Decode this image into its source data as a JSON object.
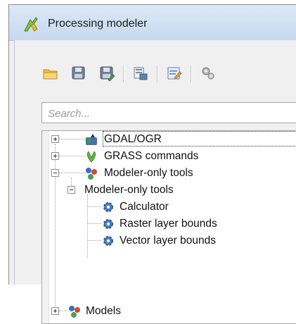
{
  "window": {
    "title": "Processing modeler"
  },
  "toolbar": {
    "buttons": [
      {
        "name": "open-model-button",
        "icon": "folder-open-icon"
      },
      {
        "name": "save-button",
        "icon": "save-icon"
      },
      {
        "name": "save-as-button",
        "icon": "save-as-icon"
      },
      {
        "name": "export-image-button",
        "icon": "export-image-icon"
      },
      {
        "name": "edit-help-button",
        "icon": "edit-help-icon"
      },
      {
        "name": "run-model-button",
        "icon": "gears-icon"
      }
    ]
  },
  "search": {
    "placeholder": "Search..."
  },
  "tree": {
    "items": [
      {
        "label": "GDAL/OGR",
        "icon": "gdal-icon",
        "expanded": false
      },
      {
        "label": "GRASS commands",
        "icon": "grass-icon",
        "expanded": false
      },
      {
        "label": "Modeler-only tools",
        "icon": "modeler-icon",
        "expanded": true
      },
      {
        "label": "Modeler-only tools",
        "expanded": true
      },
      {
        "label": "Calculator",
        "icon": "gear-icon"
      },
      {
        "label": "Raster layer bounds",
        "icon": "gear-icon"
      },
      {
        "label": "Vector layer bounds",
        "icon": "gear-icon"
      },
      {
        "label": "Models",
        "icon": "modeler-icon",
        "expanded": false
      }
    ]
  },
  "colors": {
    "titlebar": "#c7d9ef",
    "accent": "#2f6fc0"
  }
}
